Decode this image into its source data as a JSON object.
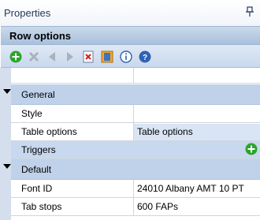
{
  "panel": {
    "title": "Properties",
    "pin_glyph": "ᵽ"
  },
  "header": {
    "title": "Row options"
  },
  "toolbar": {
    "icons": [
      "add-icon",
      "delete-icon",
      "move-left-icon",
      "move-right-icon",
      "clear-icon",
      "properties-icon",
      "info-icon",
      "help-icon"
    ],
    "accent": "#2aa52a"
  },
  "sections": {
    "general": {
      "label": "General"
    },
    "default": {
      "label": "Default"
    }
  },
  "rows": {
    "style": {
      "key": "Style",
      "value": ""
    },
    "table_options": {
      "key": "Table options",
      "value": "Table options"
    },
    "triggers": {
      "key": "Triggers"
    },
    "font_id": {
      "key": "Font ID",
      "value": "24010 Albany AMT 10 PT"
    },
    "tab_stops": {
      "key": "Tab stops",
      "value": "600 FAPs"
    }
  }
}
